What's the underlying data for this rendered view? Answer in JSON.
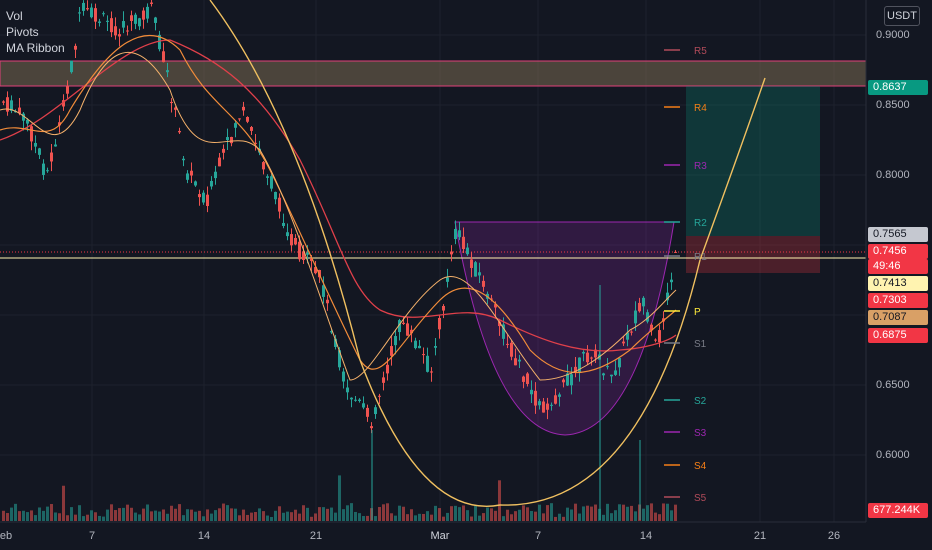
{
  "legend": {
    "vol": "Vol",
    "pivots": "Pivots",
    "ma_ribbon": "MA Ribbon"
  },
  "unit": "USDT",
  "y_axis": {
    "ticks": [
      "0.9000",
      "0.8500",
      "0.8000",
      "0.6500",
      "0.6000"
    ]
  },
  "price_tags": [
    {
      "label": "0.8637",
      "color": "#089981",
      "text": "#ffffff"
    },
    {
      "label": "0.7565",
      "color": "#c5c8d0",
      "text": "#131722"
    },
    {
      "label": "0.7456",
      "color": "#f23645",
      "text": "#ffffff"
    },
    {
      "label": "49:46",
      "color": "#f23645",
      "text": "#ffffff"
    },
    {
      "label": "0.7413",
      "color": "#fff3b0",
      "text": "#131722"
    },
    {
      "label": "0.7303",
      "color": "#f23645",
      "text": "#ffffff"
    },
    {
      "label": "0.7087",
      "color": "#d9a066",
      "text": "#131722"
    },
    {
      "label": "0.6875",
      "color": "#f23645",
      "text": "#ffffff"
    },
    {
      "label": "677.244K",
      "color": "#f23645",
      "text": "#ffffff"
    }
  ],
  "pivots": [
    {
      "label": "R5",
      "color": "#b14b5a"
    },
    {
      "label": "R4",
      "color": "#f57f17"
    },
    {
      "label": "R3",
      "color": "#9c27b0"
    },
    {
      "label": "R2",
      "color": "#26a69a"
    },
    {
      "label": "R1",
      "color": "#787b86"
    },
    {
      "label": "P",
      "color": "#ffeb3b"
    },
    {
      "label": "S1",
      "color": "#787b86"
    },
    {
      "label": "S2",
      "color": "#26a69a"
    },
    {
      "label": "S3",
      "color": "#9c27b0"
    },
    {
      "label": "S4",
      "color": "#f57f17"
    },
    {
      "label": "S5",
      "color": "#b14b5a"
    }
  ],
  "x_axis": {
    "labels": [
      "eb",
      "7",
      "14",
      "21",
      "Mar",
      "7",
      "14",
      "21",
      "26"
    ]
  },
  "colors": {
    "up": "#26a69a",
    "down": "#ef5350",
    "background": "#131722"
  }
}
